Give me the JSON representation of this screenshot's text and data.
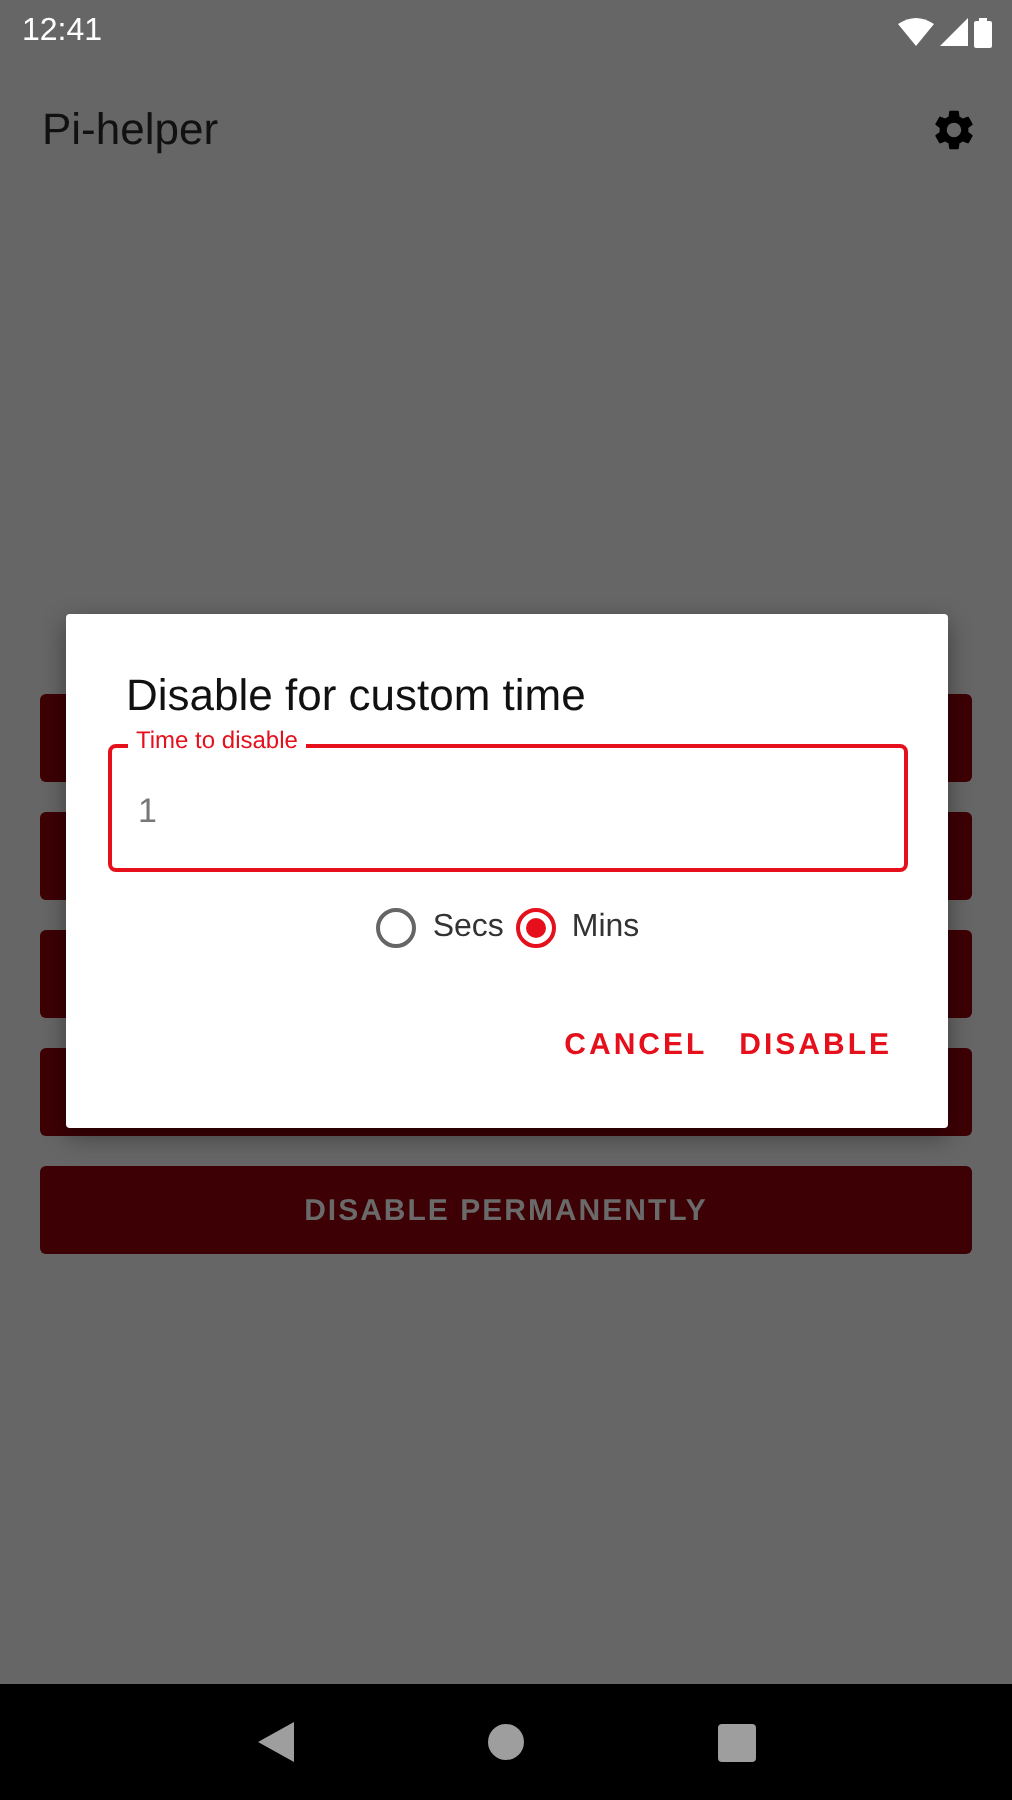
{
  "status_bar": {
    "time": "12:41"
  },
  "app_bar": {
    "title": "Pi-helper"
  },
  "buttons": [
    {
      "kind": "covered"
    },
    {
      "kind": "covered"
    },
    {
      "kind": "covered"
    },
    {
      "kind": "covered"
    },
    {
      "kind": "labeled",
      "label": "DISABLE PERMANENTLY"
    }
  ],
  "dialog": {
    "title": "Disable for custom time",
    "field": {
      "label": "Time to disable",
      "value": "1"
    },
    "units": [
      {
        "label": "Secs",
        "selected": false
      },
      {
        "label": "Mins",
        "selected": true
      }
    ],
    "actions": [
      "CANCEL",
      "DISABLE"
    ]
  }
}
